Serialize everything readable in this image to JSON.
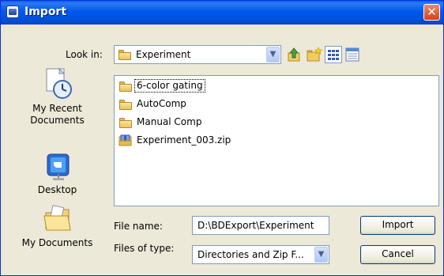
{
  "window": {
    "title": "Import"
  },
  "look_in": {
    "label": "Look in:",
    "value": "Experiment"
  },
  "places": [
    {
      "label_line1": "My Recent",
      "label_line2": "Documents",
      "icon": "recent-documents-icon"
    },
    {
      "label_line1": "Desktop",
      "label_line2": "",
      "icon": "desktop-icon"
    },
    {
      "label_line1": "My Documents",
      "label_line2": "",
      "icon": "my-documents-icon"
    }
  ],
  "files": [
    {
      "name": "6-color gating",
      "type": "folder"
    },
    {
      "name": "AutoComp",
      "type": "folder"
    },
    {
      "name": "Manual Comp",
      "type": "folder"
    },
    {
      "name": "Experiment_003.zip",
      "type": "zip"
    }
  ],
  "file_name": {
    "label": "File name:",
    "value": "D:\\BDExport\\Experiment"
  },
  "file_type": {
    "label": "Files of type:",
    "value": "Directories and Zip F..."
  },
  "buttons": {
    "import": "Import",
    "cancel": "Cancel"
  },
  "colors": {
    "titlebar": "#0058ee",
    "dialog_bg": "#ece9d8",
    "close": "#d4421c"
  }
}
